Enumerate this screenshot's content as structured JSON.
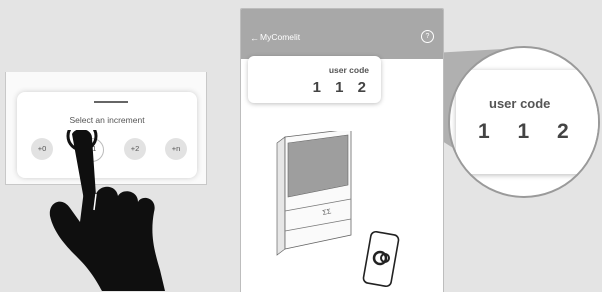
{
  "increment_panel": {
    "title": "Select an increment",
    "buttons": [
      "+0",
      "+1",
      "+2",
      "+n"
    ]
  },
  "app": {
    "back_icon": "←",
    "title": "MyComelit",
    "help_icon": "?"
  },
  "code_card": {
    "label": "user code",
    "value": "1 1 2"
  },
  "zoom": {
    "label": "user code",
    "value": "1 1 2"
  },
  "device": {
    "text": "ΣΣ"
  },
  "colors": {
    "background": "#e4e4e4",
    "header": "#a8a8a8",
    "wedge": "#b0b0b0"
  }
}
